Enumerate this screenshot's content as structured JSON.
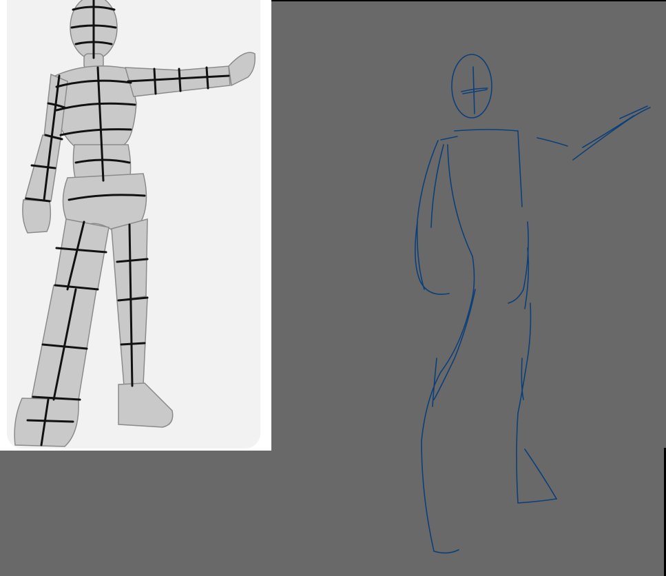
{
  "canvas": {
    "background": "#696969"
  },
  "reference": {
    "label": "",
    "figure_color": "#c9c9c9",
    "line_color": "#111111"
  },
  "sketch": {
    "stroke_color": "#0b3f7a"
  }
}
